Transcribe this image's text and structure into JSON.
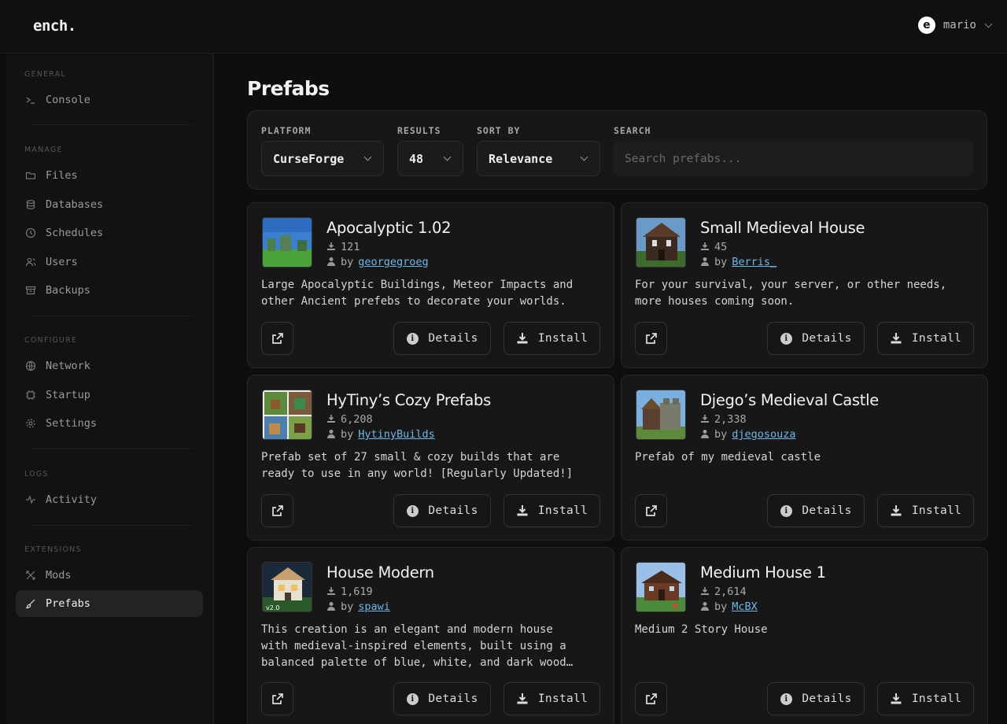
{
  "app": {
    "logo": "ench.",
    "avatar_letter": "e",
    "username": "mario"
  },
  "sidebar": {
    "sections": [
      {
        "title": "GENERAL",
        "items": [
          {
            "label": "Console",
            "icon": "terminal-icon"
          }
        ]
      },
      {
        "title": "MANAGE",
        "items": [
          {
            "label": "Files",
            "icon": "folder-icon"
          },
          {
            "label": "Databases",
            "icon": "database-icon"
          },
          {
            "label": "Schedules",
            "icon": "clock-icon"
          },
          {
            "label": "Users",
            "icon": "users-icon"
          },
          {
            "label": "Backups",
            "icon": "archive-icon"
          }
        ]
      },
      {
        "title": "CONFIGURE",
        "items": [
          {
            "label": "Network",
            "icon": "globe-icon"
          },
          {
            "label": "Startup",
            "icon": "cpu-icon"
          },
          {
            "label": "Settings",
            "icon": "gear-icon"
          }
        ]
      },
      {
        "title": "LOGS",
        "items": [
          {
            "label": "Activity",
            "icon": "activity-icon"
          }
        ]
      },
      {
        "title": "EXTENSIONS",
        "items": [
          {
            "label": "Mods",
            "icon": "puzzle-icon"
          },
          {
            "label": "Prefabs",
            "icon": "brush-icon",
            "active": true
          }
        ]
      }
    ]
  },
  "main": {
    "title": "Prefabs",
    "filters": {
      "platform_label": "PLATFORM",
      "platform_value": "CurseForge",
      "results_label": "RESULTS",
      "results_value": "48",
      "sort_label": "SORT BY",
      "sort_value": "Relevance",
      "search_label": "SEARCH",
      "search_placeholder": "Search prefabs..."
    },
    "buttons": {
      "details": "Details",
      "install": "Install"
    },
    "by_label": "by",
    "cards": [
      {
        "title": "Apocalyptic 1.02",
        "downloads": "121",
        "author": "georgegroeg",
        "description": "Large Apocalyptic Buildings, Meteor Impacts and\nother Ancient prefebs to decorate your worlds."
      },
      {
        "title": "Small Medieval House",
        "downloads": "45",
        "author": "Berris_",
        "description": "For your survival, your server, or other needs,\nmore houses coming soon."
      },
      {
        "title": "HyTiny’s Cozy Prefabs",
        "downloads": "6,208",
        "author": "HytinyBuilds",
        "description": "Prefab set of 27 small & cozy builds that are\nready to use in any world! [Regularly Updated!]"
      },
      {
        "title": "Djego’s Medieval Castle",
        "downloads": "2,338",
        "author": "djegosouza",
        "description": "Prefab of my medieval castle"
      },
      {
        "title": "House Modern",
        "downloads": "1,619",
        "author": "spawi",
        "description": "This creation is an elegant and modern house\nwith medieval-inspired elements, built using a\nbalanced palette of blue, white, and dark wood…"
      },
      {
        "title": "Medium House 1",
        "downloads": "2,614",
        "author": "McBX",
        "description": "Medium 2 Story House"
      }
    ]
  },
  "colors": {
    "accent_link": "#6cb8e8",
    "background": "#0e0e0e",
    "card": "#171717"
  }
}
